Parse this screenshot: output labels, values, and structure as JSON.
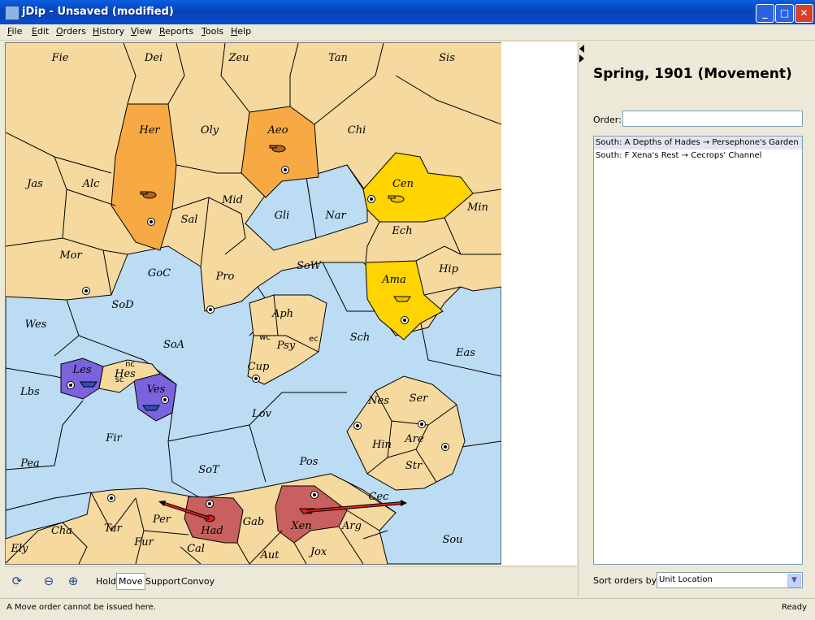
{
  "window": {
    "title": "jDip - Unsaved (modified)",
    "minimize": "_",
    "maximize": "□",
    "close": "✕"
  },
  "menu": [
    "File",
    "Edit",
    "Orders",
    "History",
    "View",
    "Reports",
    "Tools",
    "Help"
  ],
  "map": {
    "colors": {
      "neutral": "#f5d99e",
      "sea": "#bcdcf4",
      "orange": "#f7a944",
      "yellow": "#ffd400",
      "purple": "#7a63dd",
      "red": "#c86060",
      "border": "#000000"
    },
    "labels": [
      "Fie",
      "Dei",
      "Zeu",
      "Tan",
      "Sis",
      "Her",
      "Oly",
      "Aeo",
      "Chi",
      "Jas",
      "Alc",
      "Mid",
      "Sal",
      "Cen",
      "Gli",
      "Nar",
      "Min",
      "Ech",
      "Mor",
      "GoC",
      "Pro",
      "SoW",
      "Hip",
      "Ama",
      "SoD",
      "Aph",
      "Wes",
      "SoA",
      "Psy",
      "Sch",
      "Eas",
      "Cup",
      "Les",
      "Hes",
      "Ves",
      "Lbs",
      "Lov",
      "Nes",
      "Ser",
      "Fir",
      "Are",
      "Hin",
      "Pea",
      "SoT",
      "Pos",
      "Str",
      "Cec",
      "Per",
      "Tar",
      "Had",
      "Gab",
      "Xen",
      "Cha",
      "Arg",
      "Sou",
      "Fur",
      "Cal",
      "Ely",
      "Aut",
      "Jox"
    ],
    "coasts": [
      "nc",
      "sc",
      "wc",
      "ec"
    ]
  },
  "panel": {
    "phase": "Spring, 1901 (Movement)",
    "order_label": "Order:",
    "orders": [
      "South: A Depths of Hades → Persephone's Garden",
      "South: F Xena's Rest → Cecrops' Channel"
    ],
    "sort_label": "Sort orders by:",
    "sort_value": "Unit Location"
  },
  "toolbar": {
    "modes": [
      "Hold",
      "Move",
      "Support",
      "Convoy"
    ],
    "active": "Move",
    "icons": [
      "refresh-icon",
      "zoom-out-icon",
      "zoom-in-icon"
    ]
  },
  "status": {
    "message": "A Move order cannot be issued here.",
    "state": "Ready"
  }
}
